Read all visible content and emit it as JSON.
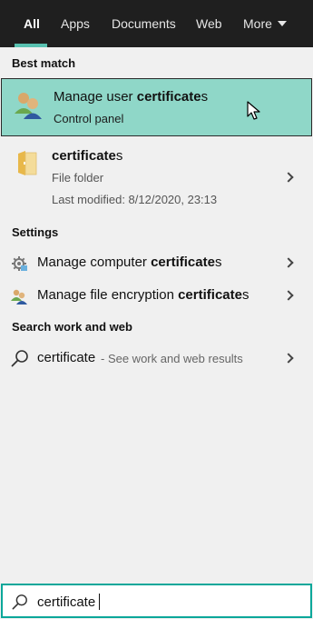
{
  "tabs": [
    {
      "label": "All",
      "active": true
    },
    {
      "label": "Apps"
    },
    {
      "label": "Documents"
    },
    {
      "label": "Web"
    },
    {
      "label": "More"
    }
  ],
  "best_match": {
    "heading": "Best match",
    "title_pre": "Manage user ",
    "title_bold": "certificate",
    "title_post": "s",
    "subtitle": "Control panel",
    "icon": "users-icon"
  },
  "folder": {
    "title_bold": "certificate",
    "title_post": "s",
    "type": "File folder",
    "modified": "Last modified: 8/12/2020, 23:13",
    "icon": "folder-icon"
  },
  "settings": {
    "heading": "Settings",
    "items": [
      {
        "pre": "Manage computer ",
        "bold": "certificate",
        "post": "s",
        "icon": "cert-settings-icon"
      },
      {
        "pre": "Manage file encryption ",
        "bold": "certificate",
        "post": "s",
        "icon": "users-key-icon"
      }
    ]
  },
  "search_web": {
    "heading": "Search work and web",
    "term": "certificate",
    "hint": "- See work and web results",
    "icon": "search-icon"
  },
  "searchbox": {
    "value": "certificate",
    "icon": "search-icon"
  },
  "colors": {
    "topbar": "#1f1f1f",
    "accent": "#58c1b0",
    "highlight": "#8fd7c8",
    "searchbox_border": "#0aa79a",
    "panel": "#f0f0f0"
  }
}
